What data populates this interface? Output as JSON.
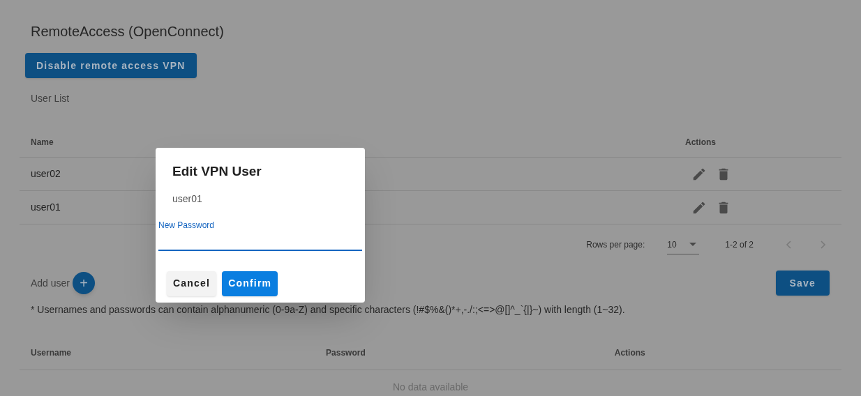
{
  "page": {
    "title": "RemoteAccess (OpenConnect)",
    "toggle_button": "Disable remote access VPN",
    "section_label": "User List"
  },
  "user_table": {
    "columns": [
      "Name",
      "Actions"
    ],
    "rows": [
      {
        "name": "user02"
      },
      {
        "name": "user01"
      }
    ],
    "pagination": {
      "rows_per_page_label": "Rows per page:",
      "rows_per_page": "10",
      "range": "1-2 of 2"
    }
  },
  "add_user": {
    "label": "Add user",
    "button": "+"
  },
  "save_button": "Save",
  "note": "* Usernames and passwords can contain alphanumeric (0-9a-Z) and specific characters (!#$%&()*+,-./:;<=>@[]^_`{|}~) with length (1~32).",
  "new_user_table": {
    "columns": [
      "Username",
      "Password",
      "Actions"
    ],
    "empty_text": "No data available"
  },
  "dialog": {
    "title": "Edit VPN User",
    "username": "user01",
    "field": {
      "label": "New Password",
      "focused": true
    },
    "buttons": [
      {
        "label": "Cancel",
        "kind": "secondary"
      },
      {
        "label": "Confirm",
        "kind": "primary"
      }
    ]
  }
}
